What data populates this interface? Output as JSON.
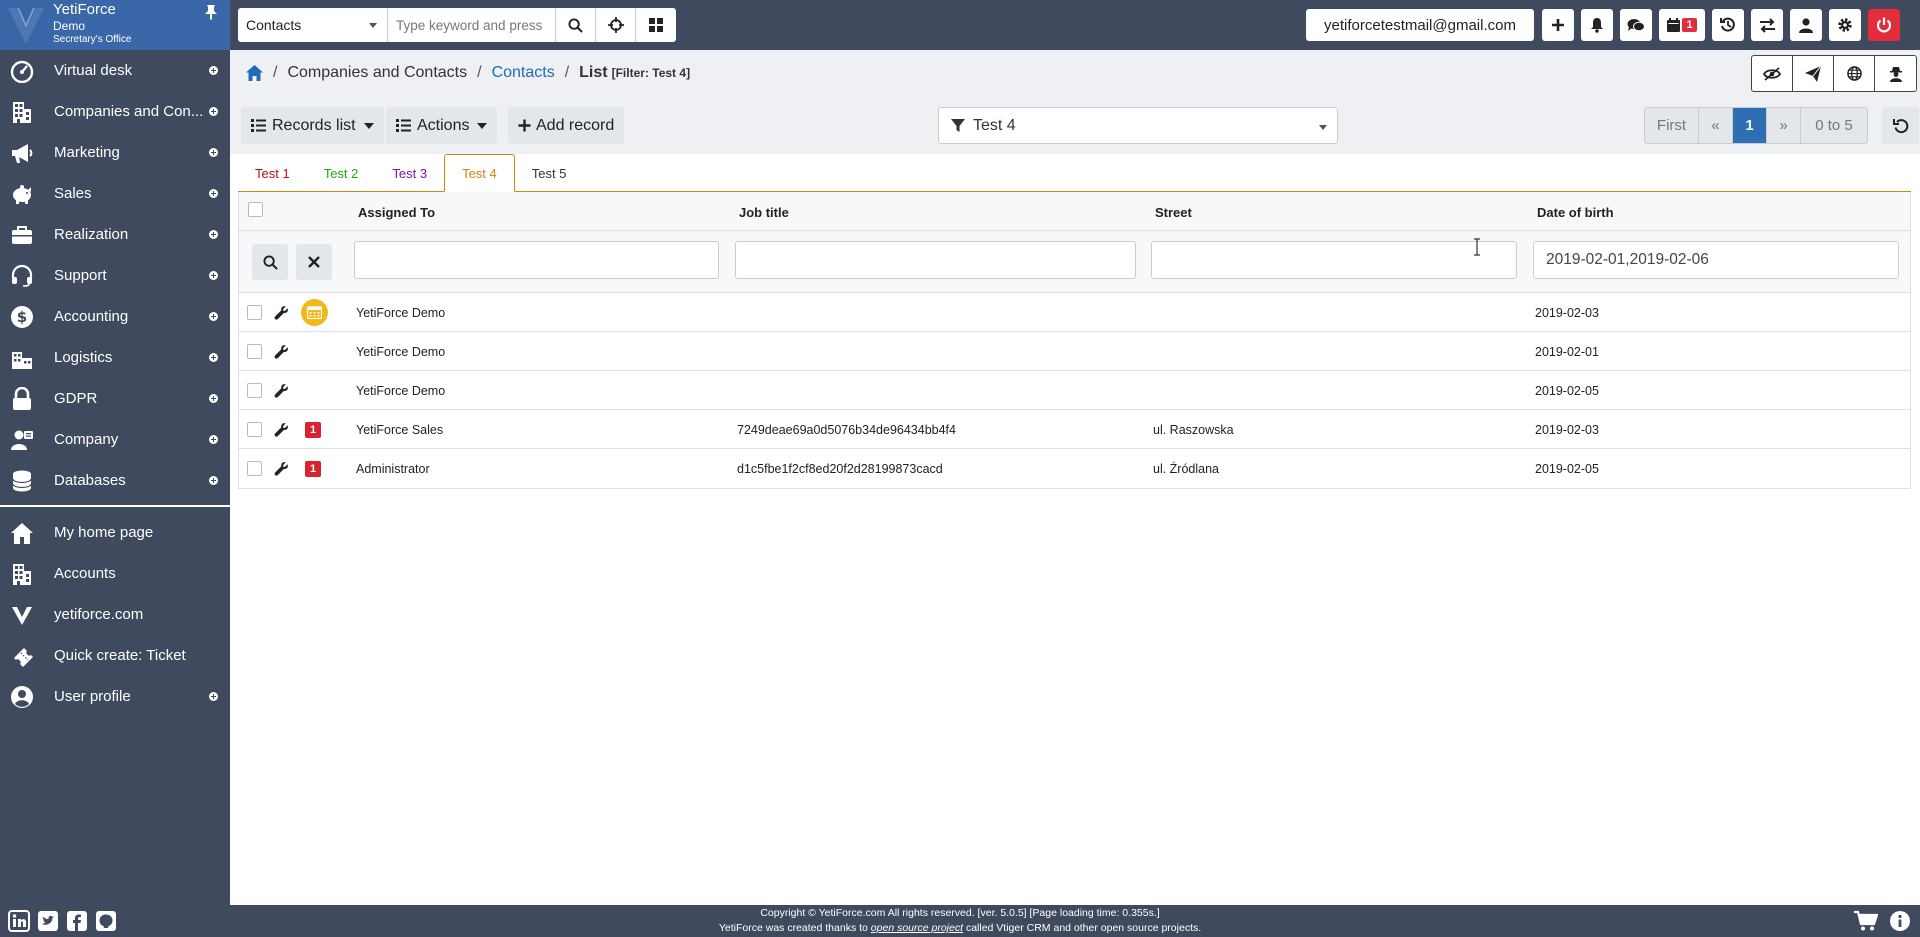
{
  "brand": {
    "company": "YetiForce",
    "user": "Demo",
    "role": "Secretary's Office"
  },
  "sidebar": {
    "modules": [
      {
        "label": "Virtual desk",
        "icon": "speedometer-icon"
      },
      {
        "label": "Companies and Con...",
        "icon": "building-icon"
      },
      {
        "label": "Marketing",
        "icon": "megaphone-icon"
      },
      {
        "label": "Sales",
        "icon": "piggy-bank-icon"
      },
      {
        "label": "Realization",
        "icon": "briefcase-icon"
      },
      {
        "label": "Support",
        "icon": "headset-icon"
      },
      {
        "label": "Accounting",
        "icon": "dollar-icon"
      },
      {
        "label": "Logistics",
        "icon": "warehouse-icon"
      },
      {
        "label": "GDPR",
        "icon": "lock-icon"
      },
      {
        "label": "Company",
        "icon": "users-icon"
      },
      {
        "label": "Databases",
        "icon": "database-icon"
      }
    ],
    "shortcuts": [
      {
        "label": "My home page",
        "icon": "home-icon",
        "plus": false
      },
      {
        "label": "Accounts",
        "icon": "building-icon",
        "plus": false
      },
      {
        "label": "yetiforce.com",
        "icon": "yeti-logo-icon",
        "plus": false
      },
      {
        "label": "Quick create: Ticket",
        "icon": "ticket-icon",
        "plus": false
      },
      {
        "label": "User profile",
        "icon": "user-circle-icon",
        "plus": true
      }
    ]
  },
  "topbar": {
    "module_select": "Contacts",
    "search_placeholder": "Type keyword and press",
    "email": "yetiforcetestmail@gmail.com",
    "reminder_badge": "1"
  },
  "breadcrumb": {
    "items": [
      "Companies and Contacts",
      "Contacts"
    ],
    "current": "List",
    "filter_label": "[Filter: Test 4]"
  },
  "toolbar": {
    "records_list": "Records list",
    "actions": "Actions",
    "add_record": "Add record",
    "filter": "Test 4",
    "pager": {
      "first": "First",
      "prev": "«",
      "current": "1",
      "next": "»",
      "range": "0 to 5"
    }
  },
  "tabs": [
    {
      "label": "Test 1",
      "color": "#b0121b",
      "active": false
    },
    {
      "label": "Test 2",
      "color": "#27a31a",
      "active": false
    },
    {
      "label": "Test 3",
      "color": "#7a15b8",
      "active": false
    },
    {
      "label": "Test 4",
      "color": "#c88a12",
      "active": true
    },
    {
      "label": "Test 5",
      "color": "#333333",
      "active": false
    }
  ],
  "table": {
    "columns": [
      "Assigned To",
      "Job title",
      "Street",
      "Date of birth"
    ],
    "filters": {
      "assigned": "",
      "job": "",
      "street": "",
      "dob": "2019-02-01,2019-02-06"
    },
    "rows": [
      {
        "assigned": "YetiForce Demo",
        "job": "",
        "street": "",
        "dob": "2019-02-03",
        "marker": "event"
      },
      {
        "assigned": "YetiForce Demo",
        "job": "",
        "street": "",
        "dob": "2019-02-01",
        "marker": ""
      },
      {
        "assigned": "YetiForce Demo",
        "job": "",
        "street": "",
        "dob": "2019-02-05",
        "marker": ""
      },
      {
        "assigned": "YetiForce Sales",
        "job": "7249deae69a0d5076b34de96434bb4f4",
        "street": "ul. Raszowska",
        "dob": "2019-02-03",
        "marker": "1"
      },
      {
        "assigned": "Administrator",
        "job": "d1c5fbe1f2cf8ed20f2d28199873cacd",
        "street": "ul. Źródlana",
        "dob": "2019-02-05",
        "marker": "1"
      }
    ]
  },
  "footer": {
    "line1": "Copyright © YetiForce.com All rights reserved. [ver. 5.0.5] [Page loading time: 0.355s.]",
    "line2_prefix": "YetiForce was created thanks to ",
    "line2_link": "open source project",
    "line2_suffix": " called Vtiger CRM and other open source projects."
  },
  "colors": {
    "sidebar": "#3f4a5e",
    "brand": "#3a67a8",
    "accent": "#2e6fb3",
    "danger": "#e22d3a",
    "event": "#f3b81a"
  }
}
